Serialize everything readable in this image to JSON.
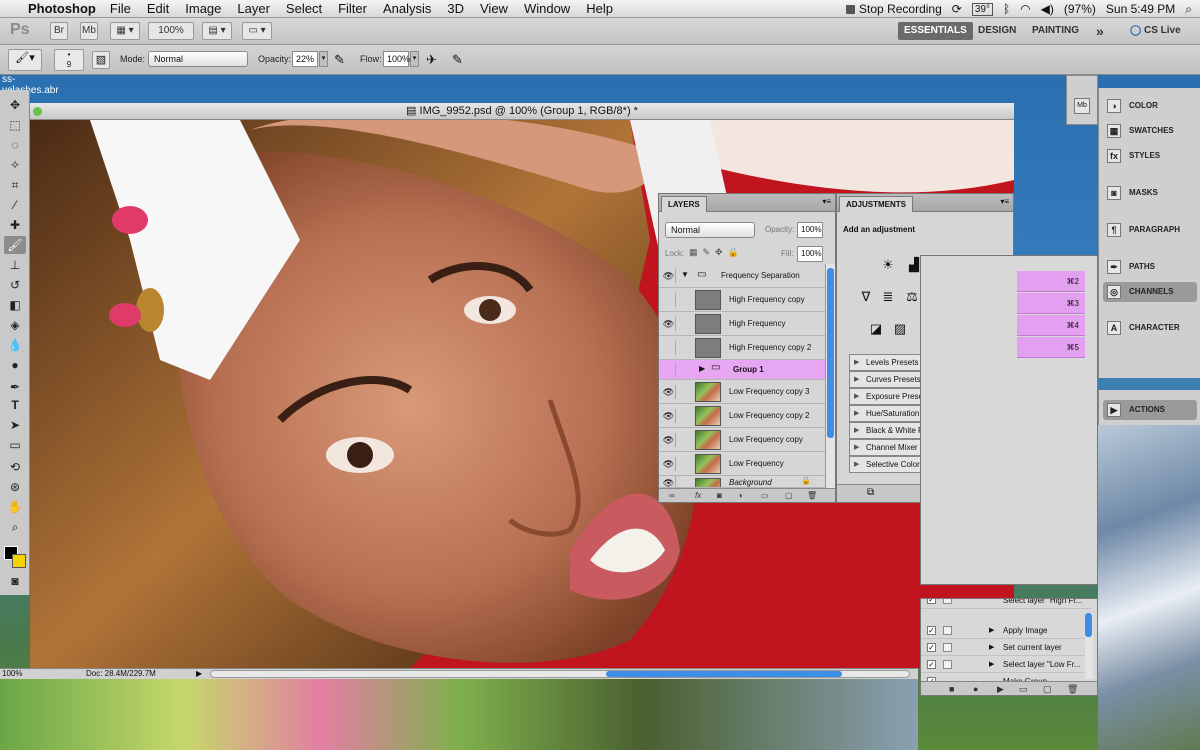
{
  "menubar": {
    "app_name": "Photoshop",
    "menus": [
      "File",
      "Edit",
      "Image",
      "Layer",
      "Select",
      "Filter",
      "Analysis",
      "3D",
      "View",
      "Window",
      "Help"
    ],
    "stop_recording": "Stop Recording",
    "temperature": "39°",
    "battery": "(97%)",
    "clock": "Sun 5:49 PM"
  },
  "appbar": {
    "logo": "Ps",
    "br_label": "Br",
    "mb_label": "Mb",
    "zoom": "100%",
    "workspaces": [
      "ESSENTIALS",
      "DESIGN",
      "PAINTING"
    ],
    "more": "»",
    "cs_live": "CS Live"
  },
  "options": {
    "brush_size": "9",
    "mode_label": "Mode:",
    "mode_value": "Normal",
    "opacity_label": "Opacity:",
    "opacity_value": "22%",
    "flow_label": "Flow:",
    "flow_value": "100%"
  },
  "desktop_label": "ss- yelashes.abr",
  "document": {
    "title": "IMG_9952.psd @ 100% (Group 1, RGB/8*) *",
    "zoom": "100%",
    "doc_size": "Doc: 28.4M/229.7M"
  },
  "layers_panel": {
    "tab": "LAYERS",
    "blend_mode": "Normal",
    "opacity_label": "Opacity:",
    "opacity_value": "100%",
    "lock_label": "Lock:",
    "fill_label": "Fill:",
    "fill_value": "100%",
    "layers": [
      {
        "name": "Frequency Separation",
        "visible": true
      },
      {
        "name": "High Frequency copy",
        "visible": false
      },
      {
        "name": "High Frequency",
        "visible": true
      },
      {
        "name": "High Frequency copy 2",
        "visible": false
      },
      {
        "name": "Group 1",
        "visible": false
      },
      {
        "name": "Low Frequency copy 3",
        "visible": true
      },
      {
        "name": "Low Frequency copy 2",
        "visible": true
      },
      {
        "name": "Low Frequency copy",
        "visible": true
      },
      {
        "name": "Low Frequency",
        "visible": true
      },
      {
        "name": "Background",
        "visible": true
      }
    ]
  },
  "adjustments_panel": {
    "tab": "ADJUSTMENTS",
    "heading": "Add an adjustment",
    "presets": [
      "Levels Presets",
      "Curves Presets",
      "Exposure Presets",
      "Hue/Saturation Presets",
      "Black & White Presets",
      "Channel Mixer Presets",
      "Selective Color Presets"
    ]
  },
  "dock": {
    "items": [
      "COLOR",
      "SWATCHES",
      "STYLES",
      "MASKS",
      "PARAGRAPH",
      "PATHS",
      "CHANNELS",
      "CHARACTER",
      "ACTIONS"
    ]
  },
  "channels": {
    "shortcuts": [
      "⌘2",
      "⌘3",
      "⌘4",
      "⌘5"
    ]
  },
  "actions": {
    "rows": [
      "Select layer \"High Fr...",
      "Apply Image",
      "Set current layer",
      "Select layer \"Low Fr...",
      "Make Group"
    ]
  },
  "colors": {
    "selection": "#e7a6f2",
    "accent_blue": "#3d8ee6"
  }
}
